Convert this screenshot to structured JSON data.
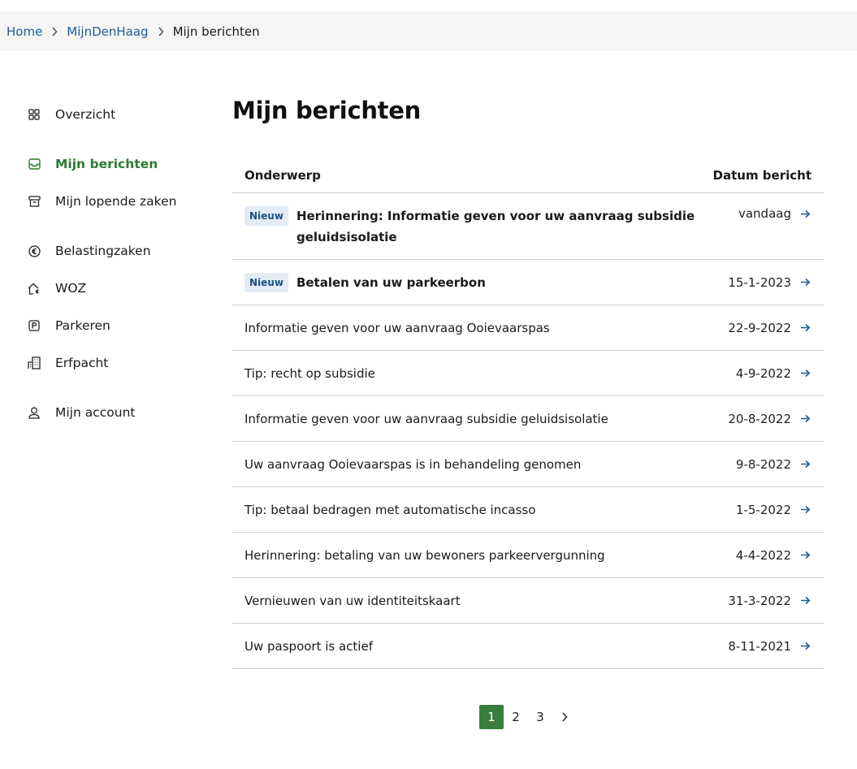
{
  "breadcrumb": {
    "items": [
      "Home",
      "MijnDenHaag"
    ],
    "current": "Mijn berichten"
  },
  "sidebar": {
    "items": [
      {
        "label": "Overzicht",
        "icon": "grid-icon"
      },
      {
        "label": "Mijn berichten",
        "icon": "inbox-icon",
        "active": true
      },
      {
        "label": "Mijn lopende zaken",
        "icon": "archive-icon"
      },
      {
        "label": "Belastingzaken",
        "icon": "euro-icon"
      },
      {
        "label": "WOZ",
        "icon": "house-euro-icon"
      },
      {
        "label": "Parkeren",
        "icon": "parking-icon"
      },
      {
        "label": "Erfpacht",
        "icon": "building-icon"
      },
      {
        "label": "Mijn account",
        "icon": "user-icon"
      }
    ]
  },
  "main": {
    "title": "Mijn berichten",
    "columns": {
      "subject": "Onderwerp",
      "date": "Datum bericht"
    },
    "badge_label": "Nieuw",
    "messages": [
      {
        "subject": "Herinnering: Informatie geven voor uw aanvraag subsidie geluidsisolatie",
        "date": "vandaag",
        "new": true
      },
      {
        "subject": "Betalen van uw parkeerbon",
        "date": "15-1-2023",
        "new": true
      },
      {
        "subject": "Informatie geven voor uw aanvraag Ooievaarspas",
        "date": "22-9-2022",
        "new": false
      },
      {
        "subject": "Tip: recht op subsidie",
        "date": "4-9-2022",
        "new": false
      },
      {
        "subject": "Informatie geven voor uw aanvraag subsidie geluidsisolatie",
        "date": "20-8-2022",
        "new": false
      },
      {
        "subject": "Uw aanvraag Ooievaarspas is in behandeling genomen",
        "date": "9-8-2022",
        "new": false
      },
      {
        "subject": "Tip: betaal bedragen met automatische incasso",
        "date": "1-5-2022",
        "new": false
      },
      {
        "subject": "Herinnering: betaling van uw bewoners parkeervergunning",
        "date": "4-4-2022",
        "new": false
      },
      {
        "subject": "Vernieuwen van uw identiteitskaart",
        "date": "31-3-2022",
        "new": false
      },
      {
        "subject": "Uw paspoort is actief",
        "date": "8-11-2021",
        "new": false
      }
    ]
  },
  "pagination": {
    "pages": [
      "1",
      "2",
      "3"
    ],
    "current": "1"
  },
  "colors": {
    "accent_green": "#3a7d3d",
    "link_blue": "#1f5b9e",
    "badge_bg": "#e3ecf6"
  }
}
